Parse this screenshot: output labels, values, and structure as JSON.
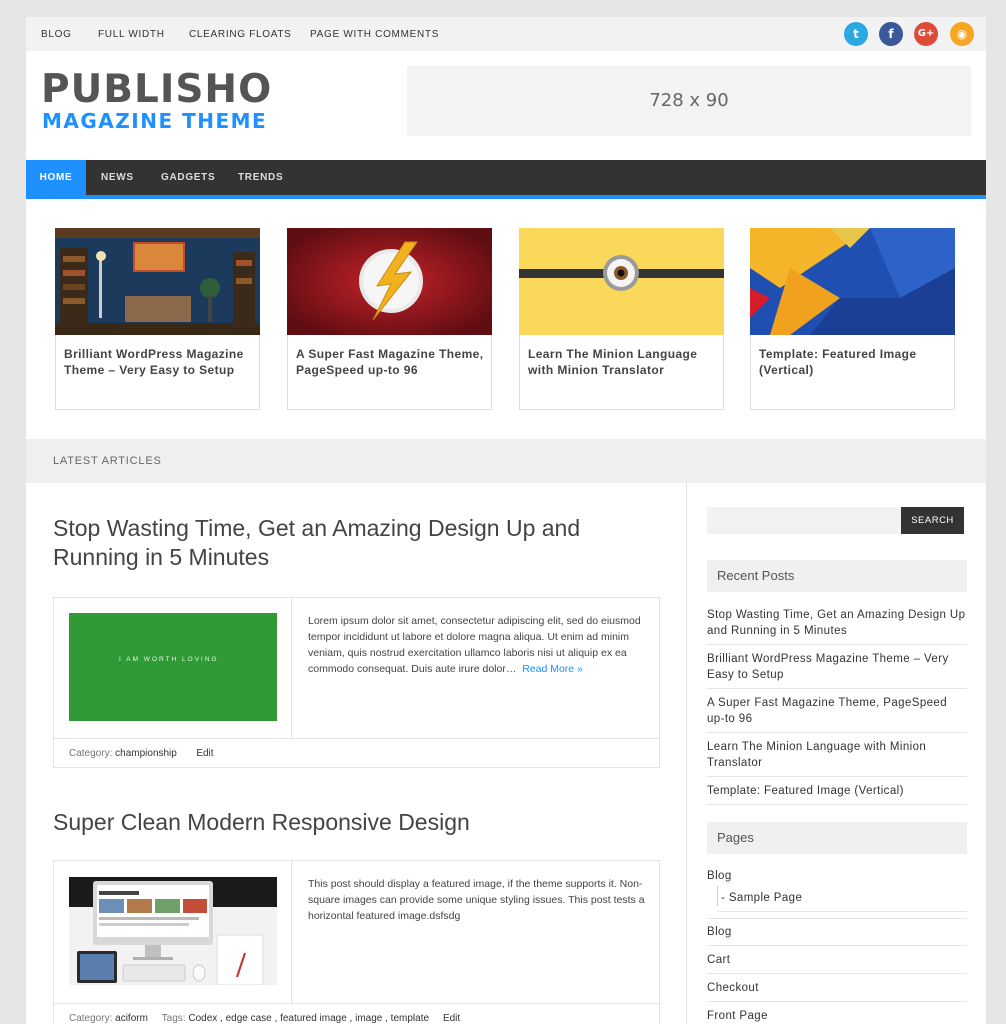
{
  "topnav": [
    "BLOG",
    "FULL WIDTH",
    "CLEARING FLOATS",
    "PAGE WITH COMMENTS"
  ],
  "social": [
    {
      "icon": "twitter-icon",
      "glyph": "t",
      "color": "#29a9e1"
    },
    {
      "icon": "facebook-icon",
      "glyph": "f",
      "color": "#3b5998"
    },
    {
      "icon": "google-plus-icon",
      "glyph": "G+",
      "color": "#dd4b39"
    },
    {
      "icon": "rss-icon",
      "glyph": "◉",
      "color": "#f6a623"
    }
  ],
  "header": {
    "logo_main": "PUBLISHO",
    "logo_sub": "MAGAZINE THEME",
    "ad_text": "728 x 90"
  },
  "mainnav": [
    "HOME",
    "NEWS",
    "GADGETS",
    "TRENDS"
  ],
  "featured": [
    "Brilliant WordPress Magazine Theme – Very Easy to Setup",
    "A Super Fast Magazine Theme, PageSpeed up-to 96",
    "Learn The Minion Language with Minion Translator",
    "Template: Featured Image (Vertical)"
  ],
  "latest_label": "LATEST ARTICLES",
  "posts": [
    {
      "title": "Stop Wasting Time, Get an Amazing Design Up and Running in 5 Minutes",
      "image_text": "I AM WORTH LOVING",
      "excerpt": "Lorem ipsum dolor sit amet, consectetur adipiscing elit, sed do eiusmod tempor incididunt ut labore et dolore magna aliqua. Ut enim ad minim veniam, quis nostrud exercitation ullamco laboris nisi ut aliquip ex ea commodo consequat. Duis aute irure dolor…",
      "read_more": "Read More »",
      "category_label": "Category:",
      "category": "championship",
      "edit": "Edit"
    },
    {
      "title": "Super Clean Modern Responsive Design",
      "excerpt": "This post should display a featured image, if the theme supports it. Non-square images can provide some unique styling issues. This post tests a horizontal featured image.dsfsdg",
      "category_label": "Category:",
      "category": "aciform",
      "tags_label": "Tags:",
      "tags": "Codex , edge case , featured image , image , template",
      "edit": "Edit"
    }
  ],
  "sidebar": {
    "search_button": "SEARCH",
    "recent_title": "Recent Posts",
    "recent": [
      "Stop Wasting Time, Get an Amazing Design Up and Running in 5 Minutes",
      "Brilliant WordPress Magazine Theme – Very Easy to Setup",
      "A Super Fast Magazine Theme, PageSpeed up-to 96",
      "Learn The Minion Language with Minion Translator",
      "Template: Featured Image (Vertical)"
    ],
    "pages_title": "Pages",
    "pages": [
      "Blog",
      "-  Sample Page",
      "Blog",
      "Cart",
      "Checkout",
      "Front Page"
    ]
  }
}
